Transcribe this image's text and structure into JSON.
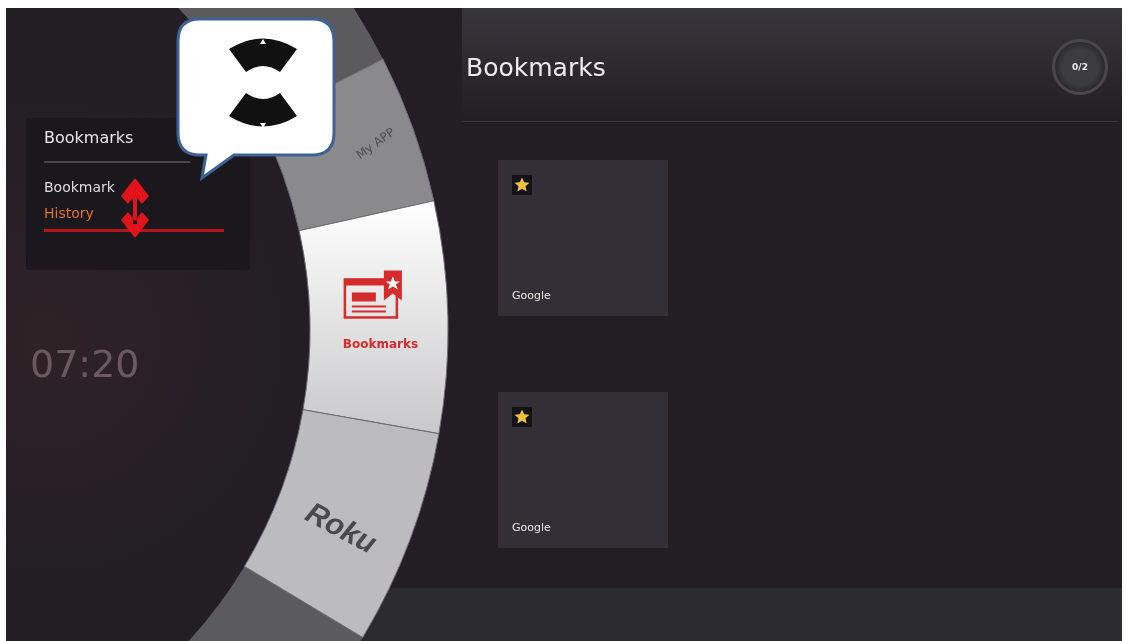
{
  "menu_panel": {
    "title": "Bookmarks",
    "items": [
      {
        "label": "Bookmark",
        "selected": false
      },
      {
        "label": "History",
        "selected": true
      }
    ]
  },
  "clock": {
    "time": "07:20"
  },
  "wheel": {
    "items": [
      {
        "label": "My APP",
        "kind": "label",
        "selected": false
      },
      {
        "label": "Bookmarks",
        "kind": "icon-label",
        "selected": true
      },
      {
        "label": "Roku",
        "kind": "logo",
        "selected": false
      }
    ]
  },
  "content": {
    "title": "Bookmarks",
    "counter": "0/2",
    "tiles": [
      {
        "label": "Google",
        "starred": true
      },
      {
        "label": "Google",
        "starred": true
      }
    ]
  }
}
